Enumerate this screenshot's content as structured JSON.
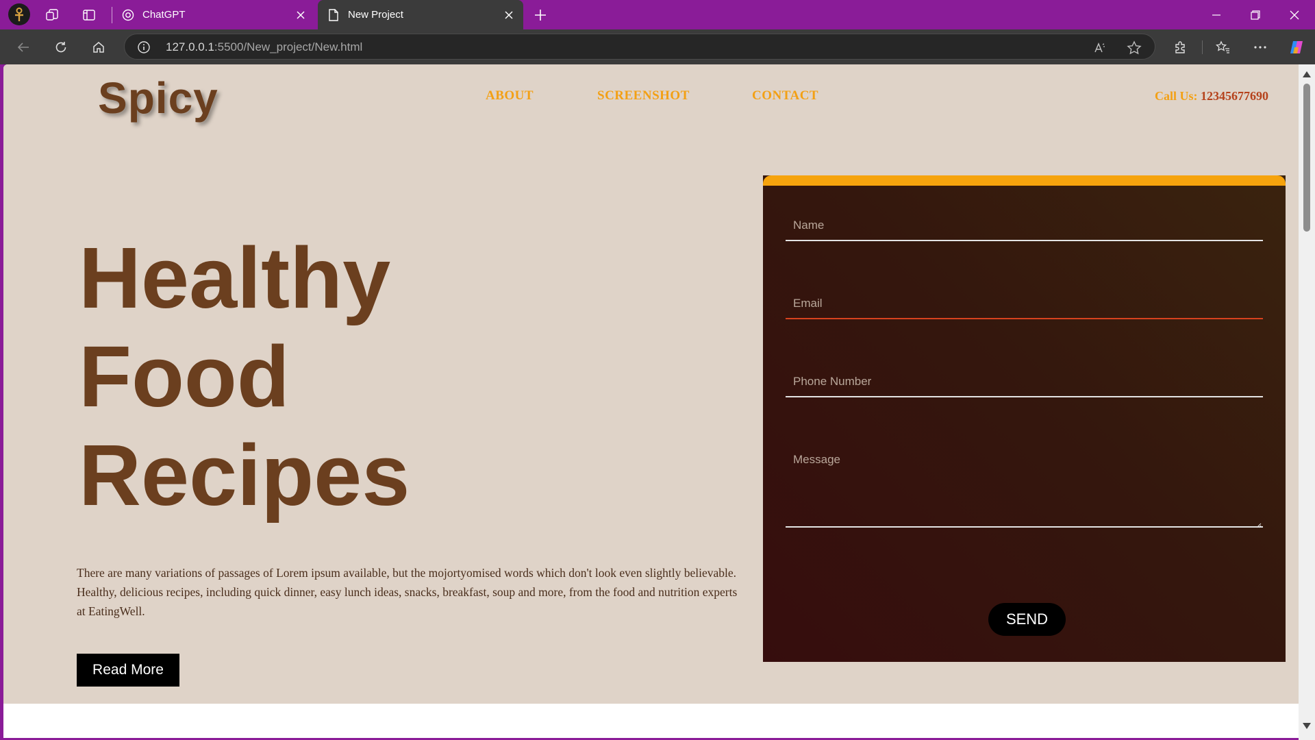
{
  "browser": {
    "tabs": [
      {
        "title": "ChatGPT",
        "active": false,
        "icon": "openai-icon"
      },
      {
        "title": "New Project",
        "active": true,
        "icon": "page-icon"
      }
    ],
    "url_host": "127.0.0.1",
    "url_path": ":5500/New_project/New.html"
  },
  "page": {
    "logo": "Spicy",
    "nav": [
      "ABOUT",
      "SCREENSHOT",
      "CONTACT"
    ],
    "call_label": "Call Us:",
    "call_number": "12345677690",
    "headline": [
      "Healthy",
      "Food",
      "Recipes"
    ],
    "description": "There are many variations of passages of Lorem ipsum available, but the mojortyomised words which don't look even slightly believable. Healthy, delicious recipes, including quick dinner, easy lunch ideas, snacks, breakfast, soup and more, from the food and nutrition experts at EatingWell.",
    "read_more": "Read More"
  },
  "form": {
    "name_placeholder": "Name",
    "email_placeholder": "Email",
    "phone_placeholder": "Phone Number",
    "message_placeholder": "Message",
    "send": "SEND"
  },
  "colors": {
    "browser_frame": "#8a1c98",
    "page_bg": "#dfd3c8",
    "brand_brown": "#6b3f1f",
    "accent_orange": "#f3a014",
    "form_bg": "#360d0d"
  }
}
